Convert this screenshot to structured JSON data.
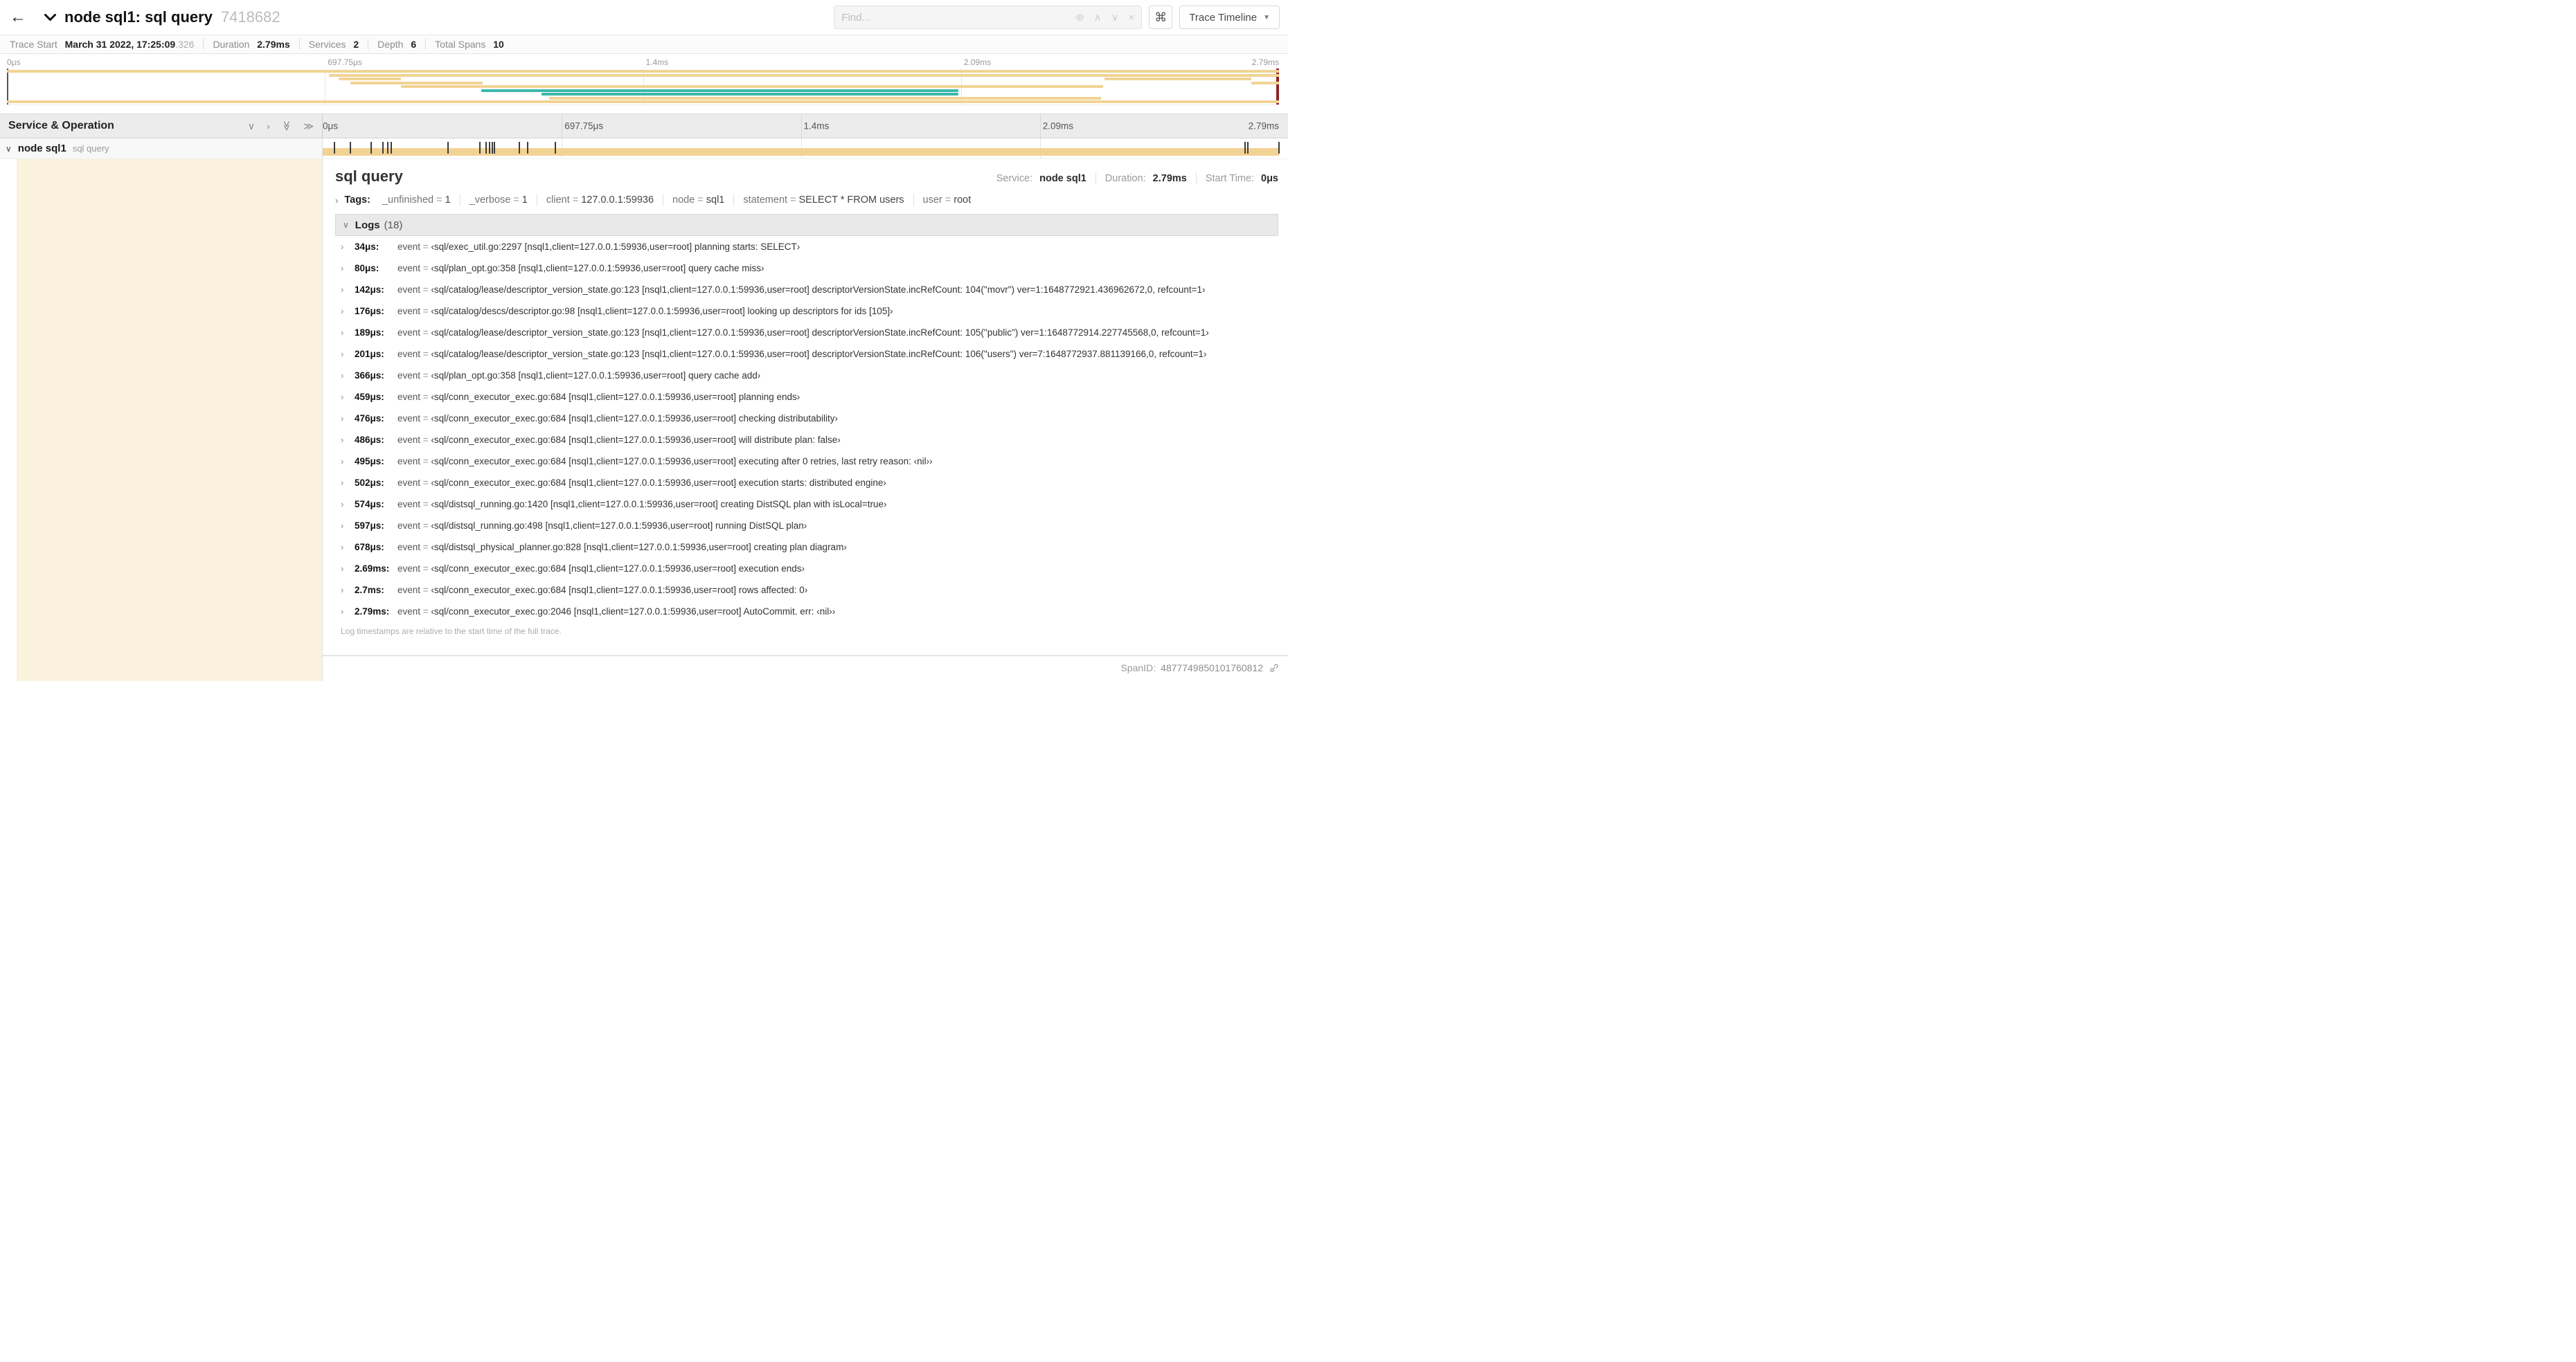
{
  "colors": {
    "tan": "#F2D394",
    "teal": "#3CB8AA",
    "cream": "#FAF2DC",
    "scrubber_left": "#555555",
    "scrubber_right": "#8E2424"
  },
  "top_bar": {
    "title": "node sql1: sql query",
    "trace_id": "7418682",
    "find_placeholder": "Find...",
    "shortcut_label": "⌘",
    "view_dropdown_label": "Trace Timeline"
  },
  "summary": {
    "items": [
      {
        "label": "Trace Start",
        "value": "March 31 2022, 17:25:09",
        "suffix": ".326"
      },
      {
        "label": "Duration",
        "value": "2.79ms",
        "suffix": ""
      },
      {
        "label": "Services",
        "value": "2",
        "suffix": ""
      },
      {
        "label": "Depth",
        "value": "6",
        "suffix": ""
      },
      {
        "label": "Total Spans",
        "value": "10",
        "suffix": ""
      }
    ]
  },
  "time_axis": [
    "0μs",
    "697.75μs",
    "1.4ms",
    "2.09ms",
    "2.79ms"
  ],
  "minimap": {
    "spans": [
      {
        "row": 0,
        "start": 0,
        "end": 100,
        "color": "tan"
      },
      {
        "row": 1,
        "start": 25.3,
        "end": 100,
        "color": "tan"
      },
      {
        "row": 2,
        "start": 26.1,
        "end": 31,
        "color": "tan"
      },
      {
        "row": 2,
        "start": 86.3,
        "end": 97.8,
        "color": "tan"
      },
      {
        "row": 3,
        "start": 27,
        "end": 37.4,
        "color": "tan"
      },
      {
        "row": 3,
        "start": 97.8,
        "end": 100,
        "color": "tan"
      },
      {
        "row": 4,
        "start": 31,
        "end": 86.2,
        "color": "tan"
      },
      {
        "row": 5,
        "start": 37.3,
        "end": 74.8,
        "color": "teal"
      },
      {
        "row": 6,
        "start": 42,
        "end": 74.8,
        "color": "teal"
      },
      {
        "row": 7,
        "start": 42.6,
        "end": 86,
        "color": "tan"
      },
      {
        "row": 8,
        "start": 0,
        "end": 100,
        "color": "tan"
      }
    ]
  },
  "timeline": {
    "left_header": "Service & Operation"
  },
  "span_row": {
    "service": "node sql1",
    "operation": "sql query",
    "duration_us": 2790,
    "log_times_us": [
      34,
      80,
      142,
      176,
      189,
      201,
      366,
      459,
      476,
      486,
      495,
      502,
      574,
      597,
      678,
      2690,
      2700,
      2790
    ]
  },
  "detail": {
    "title": "sql query",
    "meta": [
      {
        "label": "Service:",
        "value": "node sql1"
      },
      {
        "label": "Duration:",
        "value": "2.79ms"
      },
      {
        "label": "Start Time:",
        "value": "0μs"
      }
    ],
    "tags": {
      "label": "Tags:",
      "items": [
        {
          "key": "_unfinished",
          "value": "1"
        },
        {
          "key": "_verbose",
          "value": "1"
        },
        {
          "key": "client",
          "value": "127.0.0.1:59936"
        },
        {
          "key": "node",
          "value": "sql1"
        },
        {
          "key": "statement",
          "value": "SELECT * FROM users"
        },
        {
          "key": "user",
          "value": "root"
        }
      ]
    },
    "logs": {
      "title": "Logs",
      "count": "(18)",
      "field": "event",
      "eq": " = ",
      "entries": [
        {
          "time": "34μs:",
          "value": "‹sql/exec_util.go:2297 [nsql1,client=127.0.0.1:59936,user=root] planning starts: SELECT›"
        },
        {
          "time": "80μs:",
          "value": "‹sql/plan_opt.go:358 [nsql1,client=127.0.0.1:59936,user=root] query cache miss›"
        },
        {
          "time": "142μs:",
          "value": "‹sql/catalog/lease/descriptor_version_state.go:123 [nsql1,client=127.0.0.1:59936,user=root] descriptorVersionState.incRefCount: 104(\"movr\") ver=1:1648772921.436962672,0, refcount=1›"
        },
        {
          "time": "176μs:",
          "value": "‹sql/catalog/descs/descriptor.go:98 [nsql1,client=127.0.0.1:59936,user=root] looking up descriptors for ids [105]›"
        },
        {
          "time": "189μs:",
          "value": "‹sql/catalog/lease/descriptor_version_state.go:123 [nsql1,client=127.0.0.1:59936,user=root] descriptorVersionState.incRefCount: 105(\"public\") ver=1:1648772914.227745568,0, refcount=1›"
        },
        {
          "time": "201μs:",
          "value": "‹sql/catalog/lease/descriptor_version_state.go:123 [nsql1,client=127.0.0.1:59936,user=root] descriptorVersionState.incRefCount: 106(\"users\") ver=7:1648772937.881139166,0, refcount=1›"
        },
        {
          "time": "366μs:",
          "value": "‹sql/plan_opt.go:358 [nsql1,client=127.0.0.1:59936,user=root] query cache add›"
        },
        {
          "time": "459μs:",
          "value": "‹sql/conn_executor_exec.go:684 [nsql1,client=127.0.0.1:59936,user=root] planning ends›"
        },
        {
          "time": "476μs:",
          "value": "‹sql/conn_executor_exec.go:684 [nsql1,client=127.0.0.1:59936,user=root] checking distributability›"
        },
        {
          "time": "486μs:",
          "value": "‹sql/conn_executor_exec.go:684 [nsql1,client=127.0.0.1:59936,user=root] will distribute plan: false›"
        },
        {
          "time": "495μs:",
          "value": "‹sql/conn_executor_exec.go:684 [nsql1,client=127.0.0.1:59936,user=root] executing after 0 retries, last retry reason: ‹nil››"
        },
        {
          "time": "502μs:",
          "value": "‹sql/conn_executor_exec.go:684 [nsql1,client=127.0.0.1:59936,user=root] execution starts: distributed engine›"
        },
        {
          "time": "574μs:",
          "value": "‹sql/distsql_running.go:1420 [nsql1,client=127.0.0.1:59936,user=root] creating DistSQL plan with isLocal=true›"
        },
        {
          "time": "597μs:",
          "value": "‹sql/distsql_running.go:498 [nsql1,client=127.0.0.1:59936,user=root] running DistSQL plan›"
        },
        {
          "time": "678μs:",
          "value": "‹sql/distsql_physical_planner.go:828 [nsql1,client=127.0.0.1:59936,user=root] creating plan diagram›"
        },
        {
          "time": "2.69ms:",
          "value": "‹sql/conn_executor_exec.go:684 [nsql1,client=127.0.0.1:59936,user=root] execution ends›"
        },
        {
          "time": "2.7ms:",
          "value": "‹sql/conn_executor_exec.go:684 [nsql1,client=127.0.0.1:59936,user=root] rows affected: 0›"
        },
        {
          "time": "2.79ms:",
          "value": "‹sql/conn_executor_exec.go:2046 [nsql1,client=127.0.0.1:59936,user=root] AutoCommit. err: ‹nil››"
        }
      ],
      "footnote": "Log timestamps are relative to the start time of the full trace."
    },
    "span_id": {
      "label": "SpanID:",
      "value": "4877749850101760812"
    }
  }
}
